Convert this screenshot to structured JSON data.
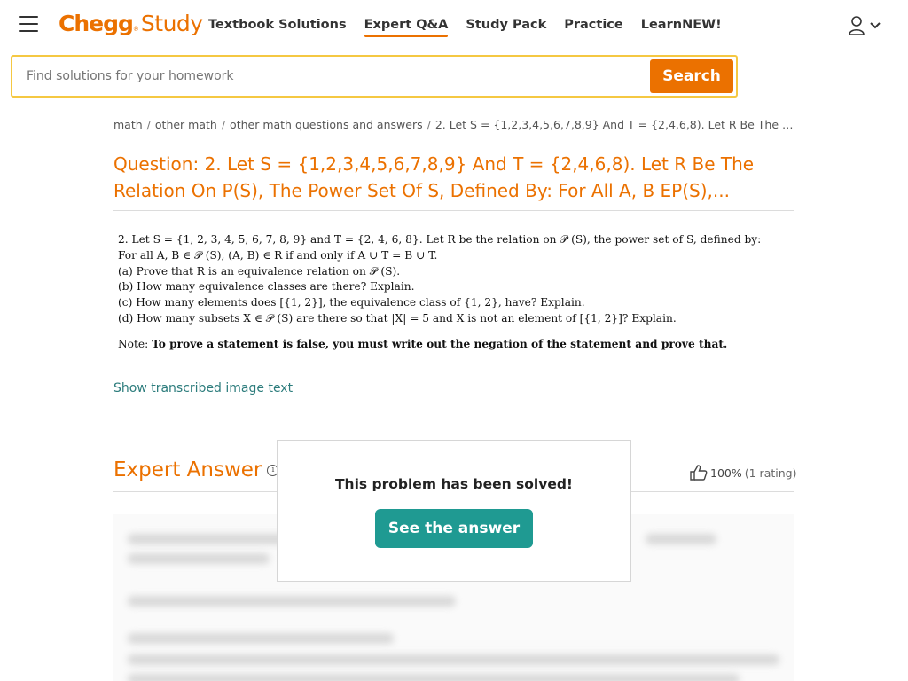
{
  "header": {
    "logo_chegg": "Chegg",
    "logo_reg": "®",
    "logo_study": "Study",
    "nav": [
      {
        "label": "Textbook Solutions"
      },
      {
        "label": "Expert Q&A"
      },
      {
        "label": "Study Pack"
      },
      {
        "label": "Practice"
      },
      {
        "label": "LearnNEW!"
      }
    ],
    "accent_color": "#eb7100"
  },
  "search": {
    "placeholder": "Find solutions for your homework",
    "value": "",
    "button_label": "Search"
  },
  "breadcrumb": {
    "items": [
      "math",
      "other math",
      "other math questions and answers",
      "2. Let S = {1,2,3,4,5,6,7,8,9} And T = {2,4,6,8). Let R Be The Relati..."
    ],
    "separator": "/"
  },
  "question": {
    "label": "Question:",
    "title": "2. Let S = {1,2,3,4,5,6,7,8,9} And T = {2,4,6,8). Let R Be The Relation On P(S), The Power Set Of S, Defined By: For All A, B EP(S),...",
    "image_lines": [
      "2. Let S = {1, 2, 3, 4, 5, 6, 7, 8, 9} and T = {2, 4, 6, 8}. Let R be the relation on 𝒫 (S), the power set of S, defined by:",
      "For all A, B ∈ 𝒫 (S), (A, B) ∈ R if and only if A ∪ T = B ∪ T.",
      "(a) Prove that R is an equivalence relation on 𝒫 (S).",
      "(b) How many equivalence classes are there? Explain.",
      "(c) How many elements does [{1, 2}], the equivalence class of {1, 2}, have? Explain.",
      "(d) How many subsets X ∈ 𝒫 (S) are there so that |X| = 5 and X is not an element of [{1, 2}]? Explain."
    ],
    "note_label": "Note:",
    "note_text": "To prove a statement is false, you must write out the negation of the statement and prove that.",
    "show_transcribed": "Show transcribed image text"
  },
  "expert_answer": {
    "title": "Expert Answer",
    "rating_percent": "100%",
    "rating_count": "(1 rating)"
  },
  "modal": {
    "message": "This problem has been solved!",
    "button_label": "See the answer",
    "button_color": "#1f9a92"
  }
}
